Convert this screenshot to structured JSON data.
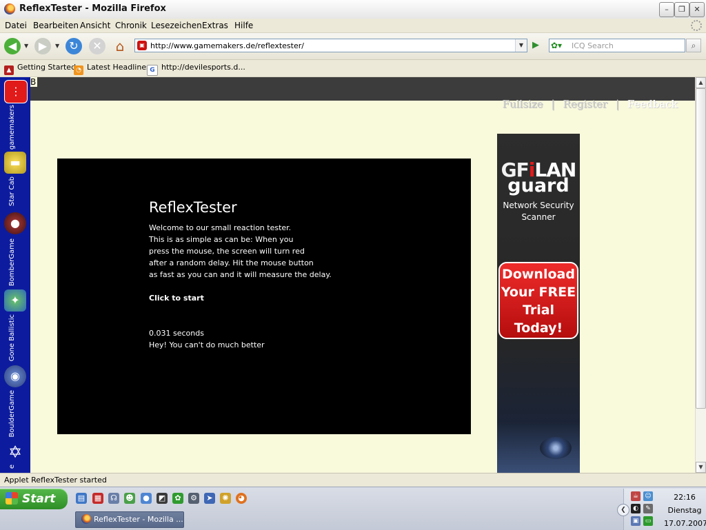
{
  "window": {
    "title": "ReflexTester - Mozilla Firefox",
    "minimize": "–",
    "maximize": "❐",
    "close": "✕"
  },
  "menubar": {
    "items": [
      "Datei",
      "Bearbeiten",
      "Ansicht",
      "Chronik",
      "Lesezeichen",
      "Extras",
      "Hilfe"
    ]
  },
  "navbar": {
    "url": "http://www.gamemakers.de/reflextester/",
    "search_placeholder": "ICQ Search"
  },
  "bookmarks": [
    {
      "label": "Getting Started",
      "icon": "hat-icon"
    },
    {
      "label": "Latest Headlines",
      "icon": "rss-icon"
    },
    {
      "label": "http://devilesports.d...",
      "icon": "google-icon"
    }
  ],
  "sidebar": {
    "items": [
      {
        "label": "gamemakers",
        "icon": "gamemakers-logo-icon"
      },
      {
        "label": "Star Cab",
        "icon": "taxi-icon"
      },
      {
        "label": "BomberGame",
        "icon": "bomb-icon"
      },
      {
        "label": "Gone Ballistic",
        "icon": "ballistic-icon"
      },
      {
        "label": "BoulderGame",
        "icon": "boulder-icon"
      },
      {
        "label": "e",
        "icon": "star-icon"
      }
    ]
  },
  "page": {
    "strip_label": "B",
    "top_links": [
      "Fullsize",
      "Register",
      "Feedback"
    ],
    "top_link_sep": "|"
  },
  "applet": {
    "title": "ReflexTester",
    "lines": [
      "Welcome to our small reaction tester.",
      "This is as simple as can be: When you",
      "press the mouse, the screen will turn red",
      "after a random delay. Hit the mouse button",
      "as fast as you can and it will measure the delay."
    ],
    "click_prompt": "Click to start",
    "result": "0.031 seconds",
    "comment": "Hey! You can't do much better"
  },
  "ad": {
    "brand_left": "GF",
    "brand_bar": "i",
    "brand_right": "LAN",
    "brand_line2": "guard",
    "subtitle_1": "Network Security",
    "subtitle_2": "Scanner",
    "cta_lines": [
      "Download",
      "Your FREE",
      "Trial",
      "Today!"
    ]
  },
  "statusbar": {
    "text": "Applet ReflexTester started"
  },
  "taskbar": {
    "start_label": "Start",
    "task_item": "ReflexTester - Mozilla ...",
    "time": "22:16",
    "day": "Dienstag",
    "date": "17.07.2007"
  }
}
